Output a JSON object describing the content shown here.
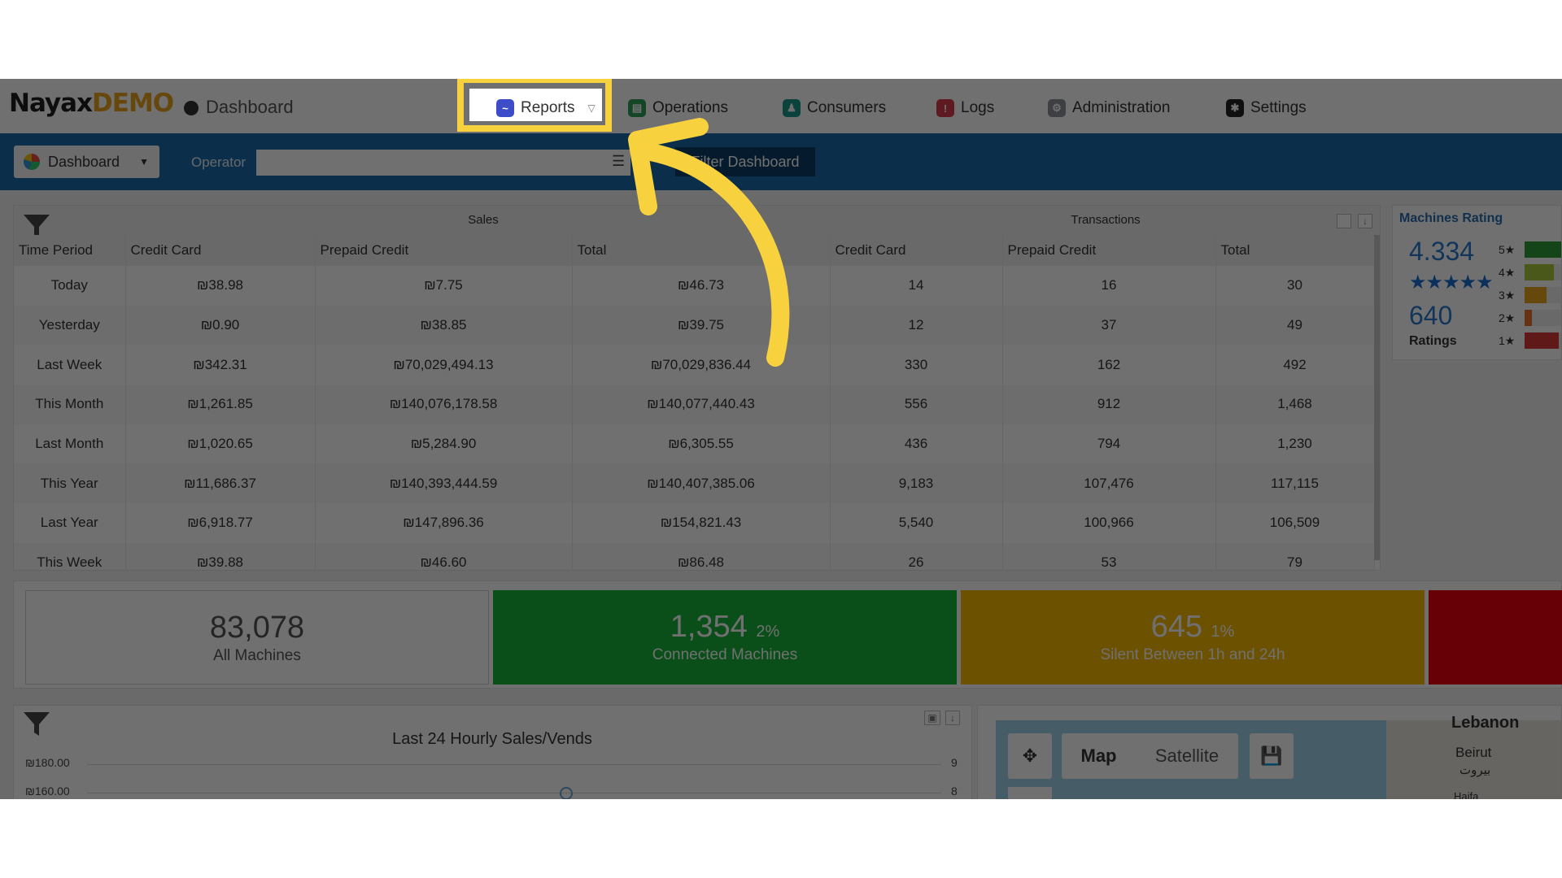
{
  "header": {
    "logo_main": "Nayax",
    "logo_demo": "DEMO",
    "breadcrumb": "Dashboard"
  },
  "nav": [
    {
      "label": "Reports",
      "icon": "reports-icon",
      "color": "#3d4cc9"
    },
    {
      "label": "Operations",
      "icon": "operations-icon",
      "color": "#2e9e58"
    },
    {
      "label": "Consumers",
      "icon": "consumers-icon",
      "color": "#1b9a8a"
    },
    {
      "label": "Logs",
      "icon": "logs-icon",
      "color": "#d93a4a"
    },
    {
      "label": "Administration",
      "icon": "administration-icon",
      "color": "#8b8f99"
    },
    {
      "label": "Settings",
      "icon": "settings-icon",
      "color": "#222222"
    }
  ],
  "filterbar": {
    "dashboard_label": "Dashboard",
    "operator_label": "Operator",
    "operator_value": "",
    "filter_button": "Filter Dashboard"
  },
  "sales_table": {
    "group_sales": "Sales",
    "group_transactions": "Transactions",
    "headers": [
      "Time Period",
      "Credit Card",
      "Prepaid Credit",
      "Total",
      "Credit Card",
      "Prepaid Credit",
      "Total"
    ],
    "rows": [
      [
        "Today",
        "₪38.98",
        "₪7.75",
        "₪46.73",
        "14",
        "16",
        "30"
      ],
      [
        "Yesterday",
        "₪0.90",
        "₪38.85",
        "₪39.75",
        "12",
        "37",
        "49"
      ],
      [
        "Last Week",
        "₪342.31",
        "₪70,029,494.13",
        "₪70,029,836.44",
        "330",
        "162",
        "492"
      ],
      [
        "This Month",
        "₪1,261.85",
        "₪140,076,178.58",
        "₪140,077,440.43",
        "556",
        "912",
        "1,468"
      ],
      [
        "Last Month",
        "₪1,020.65",
        "₪5,284.90",
        "₪6,305.55",
        "436",
        "794",
        "1,230"
      ],
      [
        "This Year",
        "₪11,686.37",
        "₪140,393,444.59",
        "₪140,407,385.06",
        "9,183",
        "107,476",
        "117,115"
      ],
      [
        "Last Year",
        "₪6,918.77",
        "₪147,896.36",
        "₪154,821.43",
        "5,540",
        "100,966",
        "106,509"
      ],
      [
        "This Week",
        "₪39.88",
        "₪46.60",
        "₪86.48",
        "26",
        "53",
        "79"
      ]
    ]
  },
  "machines_rating": {
    "title": "Machines Rating",
    "score": "4.334",
    "stars": "★★★★★",
    "count": "640",
    "count_label": "Ratings",
    "bars": [
      {
        "label": "5★",
        "color": "#2e9e3a",
        "level": 0.9
      },
      {
        "label": "4★",
        "color": "#a8c93c",
        "level": 0.6
      },
      {
        "label": "3★",
        "color": "#e8a21c",
        "level": 0.45
      },
      {
        "label": "2★",
        "color": "#e8732c",
        "level": 0.15
      },
      {
        "label": "1★",
        "color": "#d93a3a",
        "level": 0.7
      }
    ]
  },
  "tiles": [
    {
      "number": "83,078",
      "percent": "",
      "label": "All Machines",
      "bg": "#ffffff",
      "fg": "#555555"
    },
    {
      "number": "1,354",
      "percent": "2%",
      "label": "Connected Machines",
      "bg": "#17b43a",
      "fg": "#ffffff"
    },
    {
      "number": "645",
      "percent": "1%",
      "label": "Silent Between 1h and 24h",
      "bg": "#f6b800",
      "fg": "#ffffff"
    },
    {
      "number": "",
      "percent": "",
      "label": "",
      "bg": "#e8000e",
      "fg": "#ffffff"
    }
  ],
  "hourly_chart": {
    "title": "Last 24 Hourly Sales/Vends",
    "y_left": [
      "₪180.00",
      "₪160.00"
    ],
    "y_right": [
      "9",
      "8"
    ]
  },
  "map": {
    "map_label": "Map",
    "satellite_label": "Satellite",
    "place_1": "Lebanon",
    "place_2": "Beirut",
    "place_3": "بيروت",
    "place_4": "Haifa"
  },
  "colors": {
    "accent_blue": "#1a6aa8",
    "highlight": "#f7d23e",
    "arrow": "#f7d23e"
  }
}
